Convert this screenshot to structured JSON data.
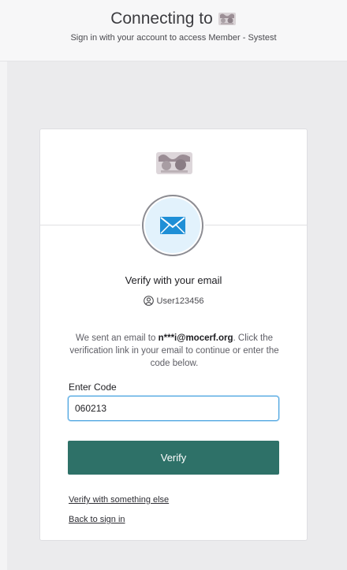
{
  "header": {
    "title": "Connecting to",
    "subtitle": "Sign in with your account to access Member - Systest",
    "logo_icon": "org-logo-icon"
  },
  "card": {
    "logo_icon": "org-logo-icon",
    "factor_icon": "envelope-icon",
    "heading": "Verify with your email",
    "username": "User123456",
    "user_icon": "user-circle-icon",
    "description_prefix": "We sent an email to ",
    "description_email": "n***i@mocerf.org",
    "description_suffix": ". Click the verification link in your email to continue or enter the code below.",
    "code_label": "Enter Code",
    "code_value": "060213",
    "verify_label": "Verify",
    "links": {
      "other_method": "Verify with something else",
      "back": "Back to sign in"
    }
  },
  "colors": {
    "primary_button": "#2e7168",
    "input_focus": "#4aa3df",
    "envelope": "#1f8fd6",
    "circle_fill": "#e2f2fc",
    "page_bg": "#ebebed"
  }
}
